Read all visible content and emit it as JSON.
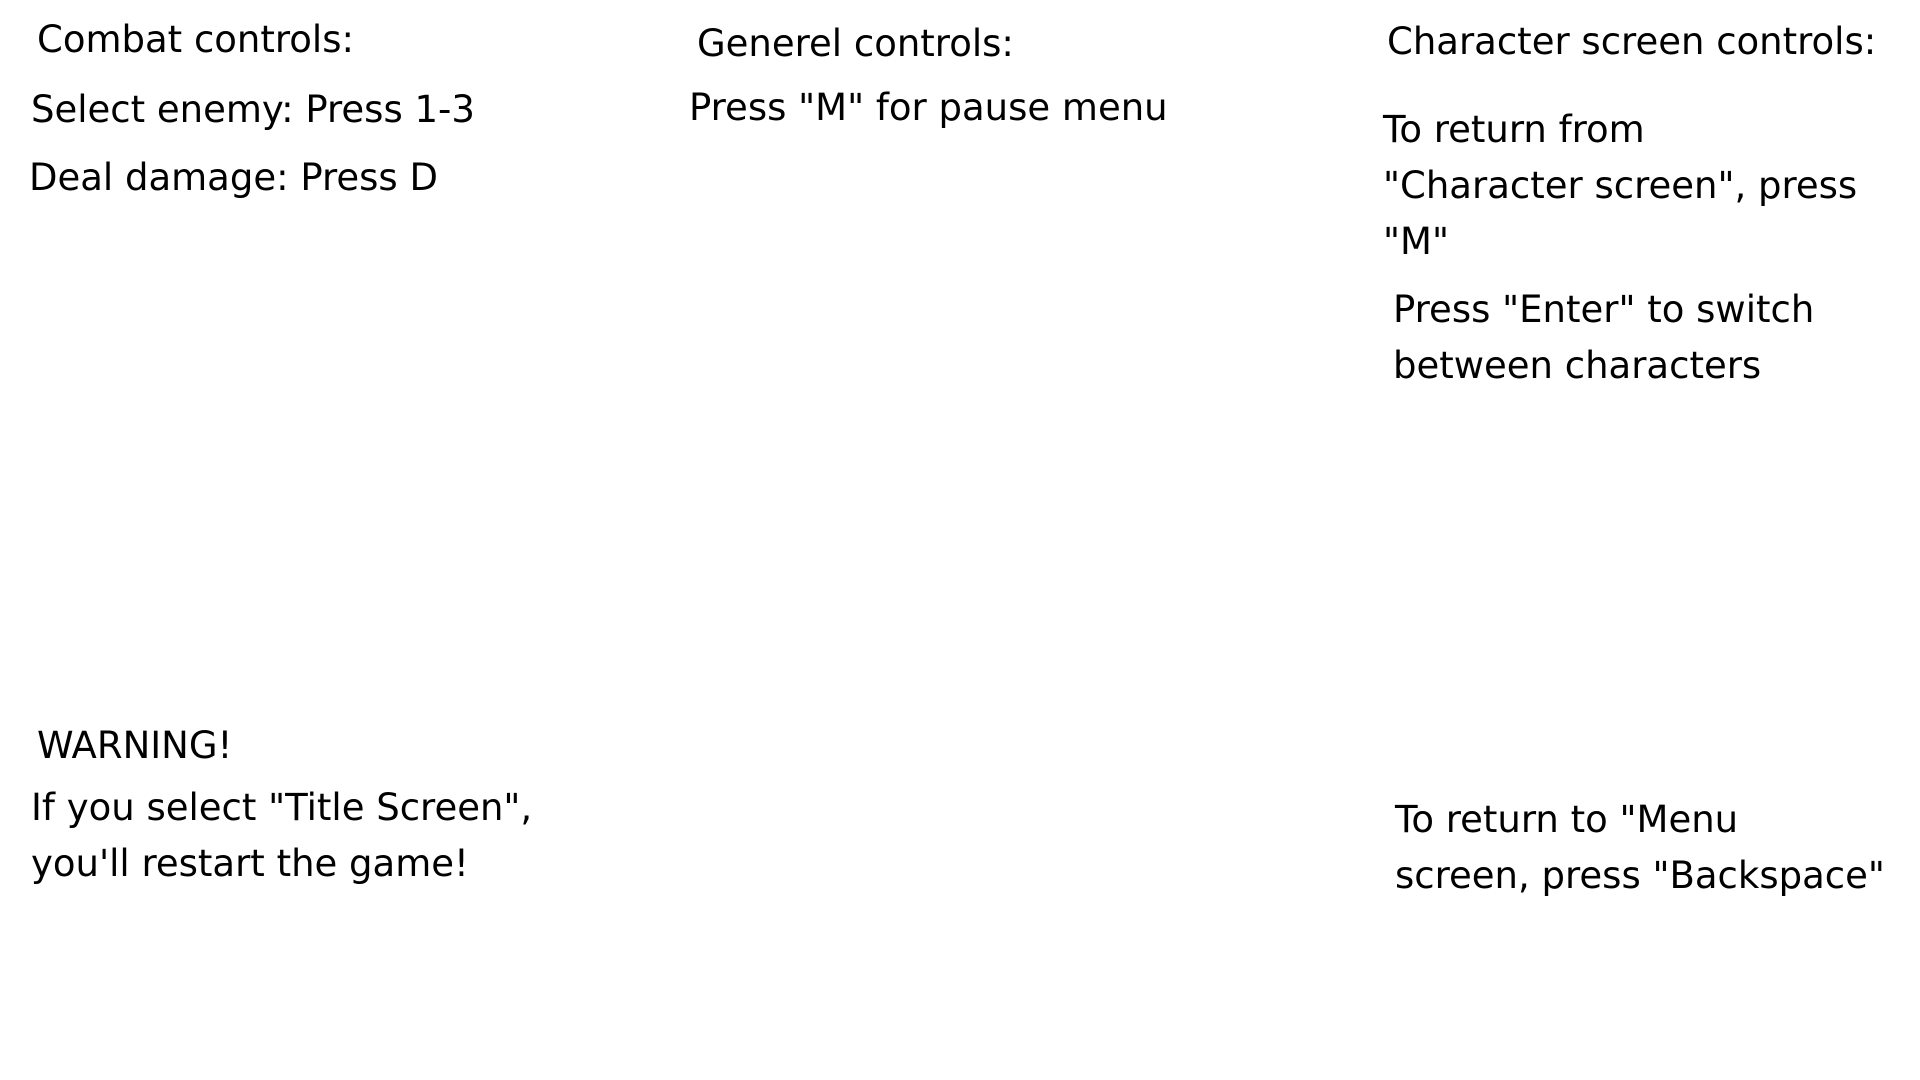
{
  "combat": {
    "heading": "Combat controls:",
    "select_enemy": "Select enemy: Press 1-3",
    "deal_damage": "Deal damage: Press D"
  },
  "general": {
    "heading": "Generel controls:",
    "pause": "Press \"M\" for pause menu"
  },
  "character_screen": {
    "heading": "Character screen controls:",
    "return_from_line1": "To return from",
    "return_from_line2": "\"Character screen\", press",
    "return_from_line3": "\"M\"",
    "switch_line1": "Press \"Enter\" to switch",
    "switch_line2": "between characters"
  },
  "warning": {
    "heading": "WARNING!",
    "line1": "If you select \"Title Screen\",",
    "line2": "you'll restart the game!"
  },
  "menu_return": {
    "line1": "To return to \"Menu",
    "line2": "screen, press \"Backspace\""
  }
}
